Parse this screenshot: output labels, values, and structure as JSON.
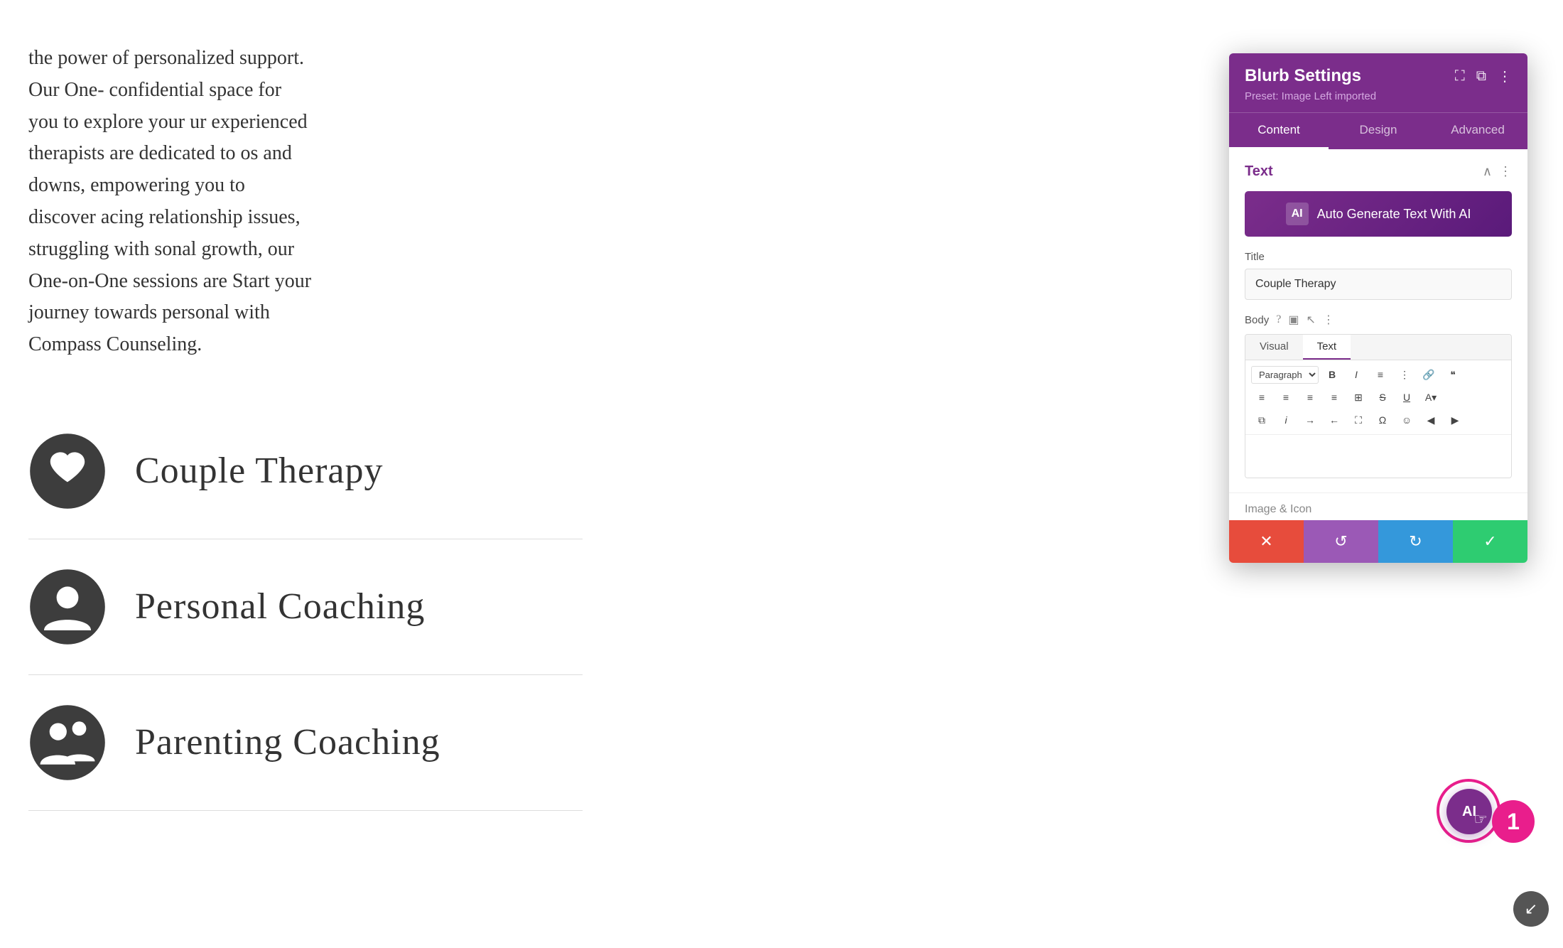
{
  "page": {
    "background_color": "#ffffff"
  },
  "left": {
    "body_text": "the power of personalized support. Our One-\nconfidential space for you to explore your\nur experienced therapists are dedicated to\nos and downs, empowering you to discover\nacing relationship issues, struggling with\nsonal growth, our One-on-One sessions are\nStart your journey towards personal\nwith Compass Counseling.",
    "services": [
      {
        "id": "couple-therapy",
        "label": "Couple Therapy",
        "icon": "heart"
      },
      {
        "id": "personal-coaching",
        "label": "Personal Coaching",
        "icon": "person"
      },
      {
        "id": "parenting-coaching",
        "label": "Parenting Coaching",
        "icon": "family"
      }
    ]
  },
  "panel": {
    "title": "Blurb Settings",
    "preset_label": "Preset: Image Left imported",
    "tabs": [
      "Content",
      "Design",
      "Advanced"
    ],
    "active_tab": "Content",
    "header_icons": [
      "fullscreen",
      "split",
      "more"
    ],
    "text_section": {
      "title": "Text",
      "ai_button_label": "Auto Generate Text With AI",
      "title_field_label": "Title",
      "title_field_value": "Couple Therapy",
      "body_field_label": "Body",
      "body_icons": [
        "question",
        "mobile",
        "cursor",
        "more"
      ],
      "editor_tabs": [
        "Visual",
        "Text"
      ],
      "active_editor_tab": "Text",
      "toolbar": {
        "paragraph_select": "Paragraph",
        "row1": [
          "B",
          "I",
          "ul",
          "ol",
          "link",
          "quote"
        ],
        "row2": [
          "align-left",
          "align-center",
          "align-right",
          "align-justify",
          "table",
          "strikethrough",
          "underline",
          "color"
        ],
        "row3": [
          "copy",
          "italic2",
          "indent",
          "outdent",
          "fullscreen",
          "omega",
          "emoji",
          "undo",
          "redo"
        ]
      }
    },
    "image_icon_section_label": "Image & Icon",
    "footer_buttons": {
      "cancel_icon": "✕",
      "reset_icon": "↺",
      "redo_icon": "↻",
      "confirm_icon": "✓"
    }
  },
  "floating": {
    "ai_icon": "AI",
    "badge_number": "1"
  }
}
